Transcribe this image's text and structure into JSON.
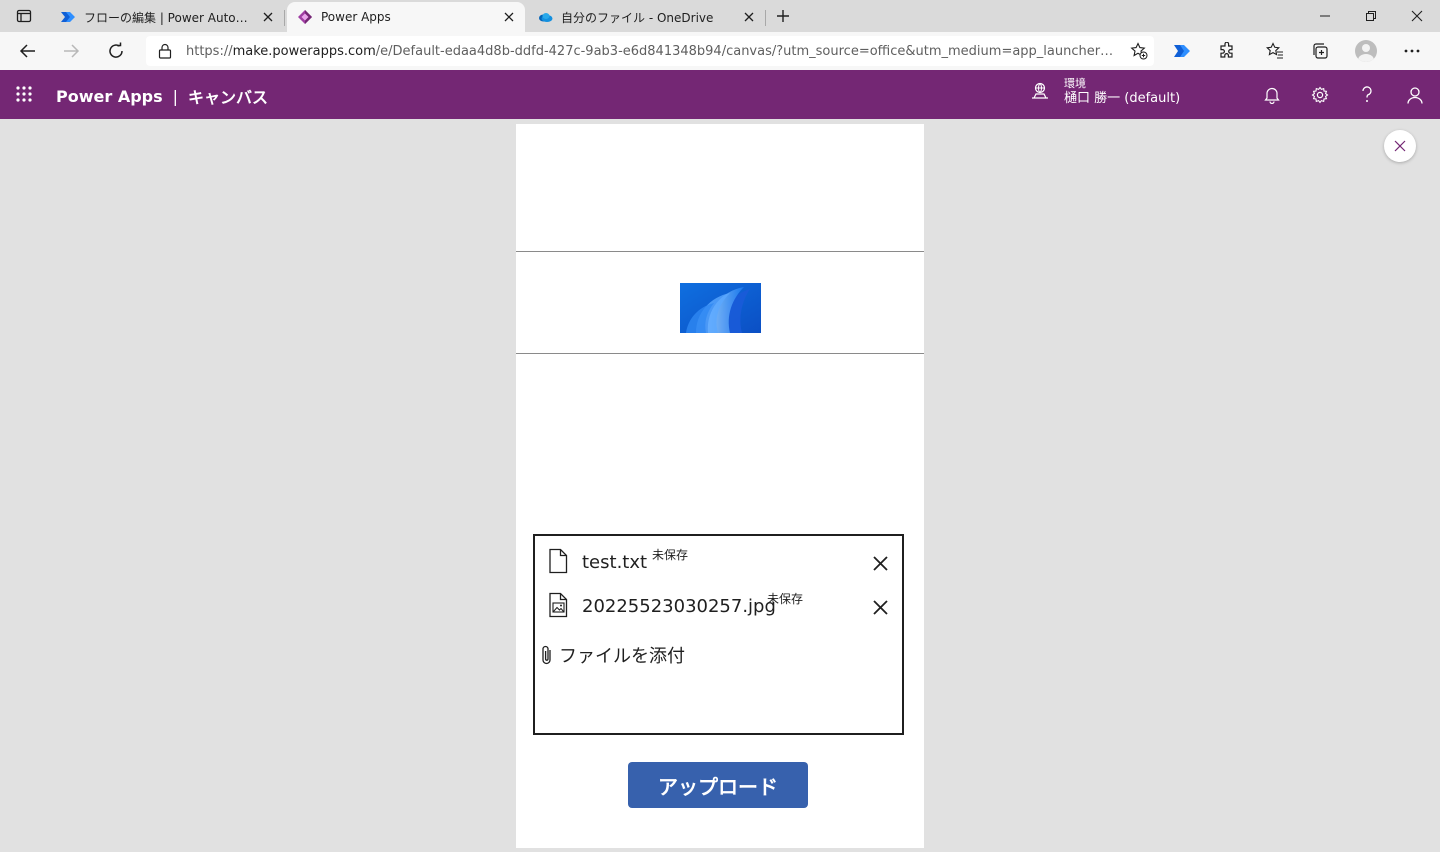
{
  "browser": {
    "tabs": [
      {
        "title": "フローの編集 | Power Automate",
        "icon": "power-automate-icon",
        "active": false
      },
      {
        "title": "Power Apps",
        "icon": "power-apps-icon",
        "active": true
      },
      {
        "title": "自分のファイル - OneDrive",
        "icon": "onedrive-icon",
        "active": false
      }
    ],
    "url_prefix": "https://",
    "url_host": "make.powerapps.com",
    "url_path": "/e/Default-edaa4d8b-ddfd-427c-9ab3-e6d841348b94/canvas/?utm_source=office&utm_medium=app_launcher&utm_..."
  },
  "header": {
    "product": "Power Apps",
    "separator": "|",
    "section": "キャンバス",
    "env_label": "環境",
    "env_name": "樋口 勝一 (default)"
  },
  "attachments": {
    "items": [
      {
        "name": "test.txt",
        "status": "未保存",
        "type": "document"
      },
      {
        "name": "20225523030257.jpg",
        "status": "未保存",
        "type": "image"
      }
    ],
    "add_label": "ファイルを添付"
  },
  "upload_button": {
    "label": "アップロード"
  },
  "colors": {
    "header_bg": "#742774",
    "button_bg": "#3761ad",
    "canvas_bg": "#e1e1e1"
  }
}
